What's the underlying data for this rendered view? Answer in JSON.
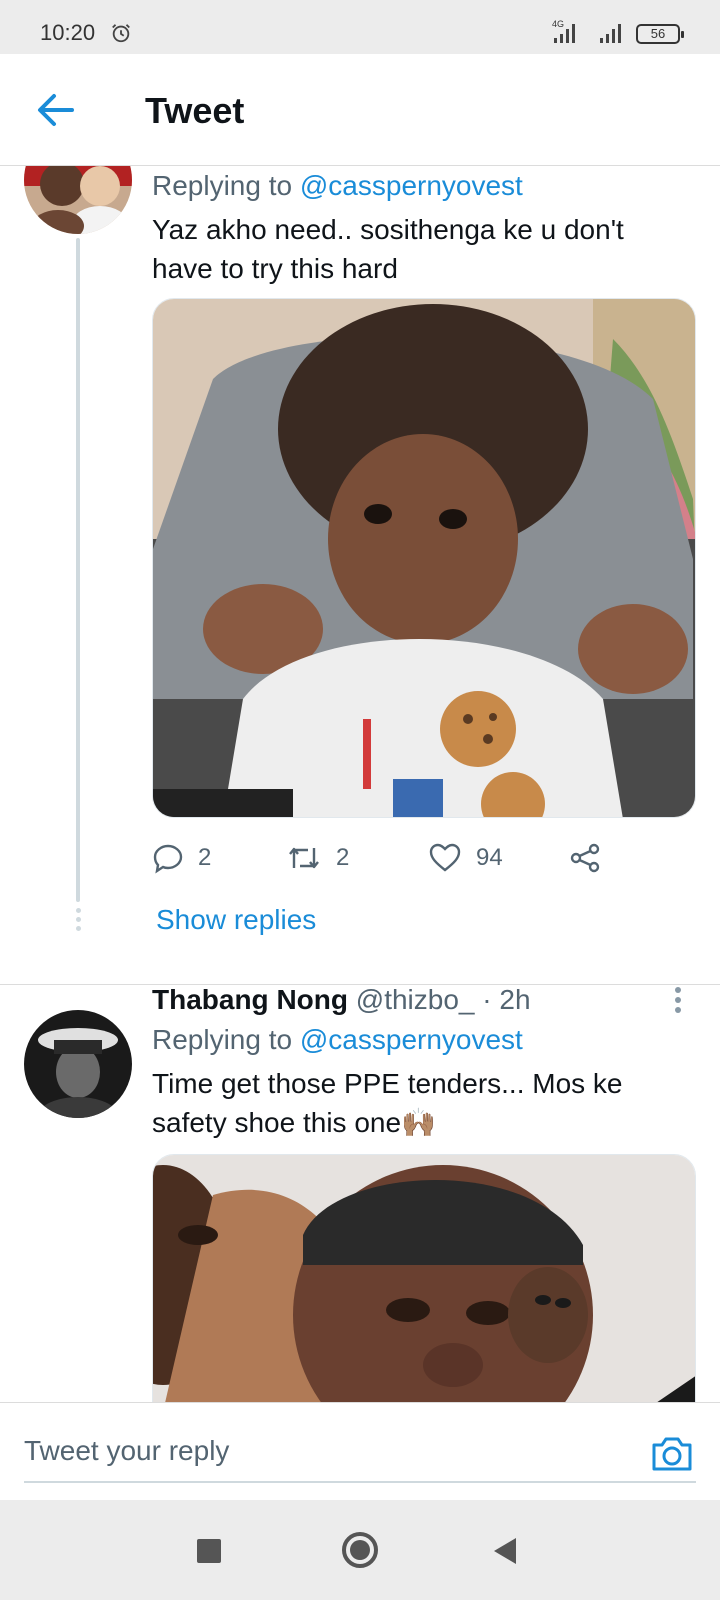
{
  "status_bar": {
    "time": "10:20",
    "network": "4G",
    "battery": "56"
  },
  "header": {
    "title": "Tweet"
  },
  "tweets": [
    {
      "replying_prefix": "Replying to",
      "replying_handle": "@casspernyovest",
      "text": "Yaz akho need.. sosithenga ke u don't have to try this hard",
      "replies": "2",
      "retweets": "2",
      "likes": "94",
      "show_replies": "Show replies"
    },
    {
      "display_name": "Thabang Nong",
      "handle": "@thizbo_",
      "time": "· 2h",
      "replying_prefix": "Replying to",
      "replying_handle": "@casspernyovest",
      "text": "Time get those PPE tenders... Mos ke safety shoe this one🙌🏽"
    }
  ],
  "reply_bar": {
    "placeholder": "Tweet your reply"
  },
  "colors": {
    "accent": "#1a8cd8",
    "secondary_text": "#536471",
    "divider": "#dcdcdc"
  }
}
